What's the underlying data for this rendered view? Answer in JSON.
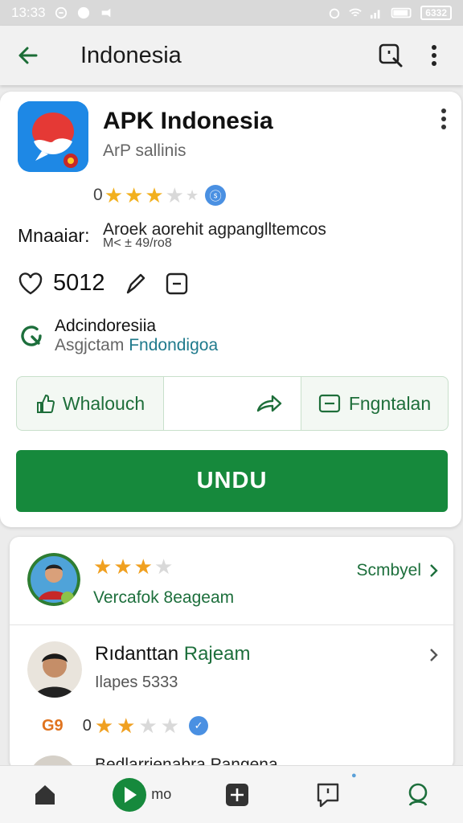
{
  "status_bar": {
    "time": "13:33",
    "battery": "6332"
  },
  "appbar": {
    "title": "Indonesia"
  },
  "app": {
    "name": "APK Indonesia",
    "subtitle": "ArP sallinis",
    "rating_prefix": "0",
    "rating_stars": 3,
    "rating_out_of": 5,
    "meta_label": "Mnaaiar:",
    "meta_value": "Aroek aorehit agpanglltemcos",
    "meta_value2": "M< ± 49/ro8",
    "likes": "5012",
    "developer_line1": "Adcindoresiia",
    "developer_line2_prefix": "Asgjctam",
    "developer_line2_accent": "Fndondigoa",
    "btn_left": "Whalouch",
    "btn_right": "Fngntalan",
    "download": "UNDU"
  },
  "reviews": [
    {
      "stars": 3,
      "sub": "Vercafok 8eageam",
      "link": "Scmbyel"
    },
    {
      "name_prefix": "Rıdanttan",
      "name_accent": "Rajeam",
      "sub": "Ilapes 5333",
      "badge": "G9",
      "rating_prefix": "0",
      "stars": 2
    }
  ],
  "peek_review": {
    "text": "Bedlarrienabra Pangena"
  },
  "bottom_nav": {
    "center_label": "mo"
  },
  "colors": {
    "brand_green": "#16893c",
    "star": "#f2b01e",
    "accent_teal": "#1f7a8c"
  }
}
